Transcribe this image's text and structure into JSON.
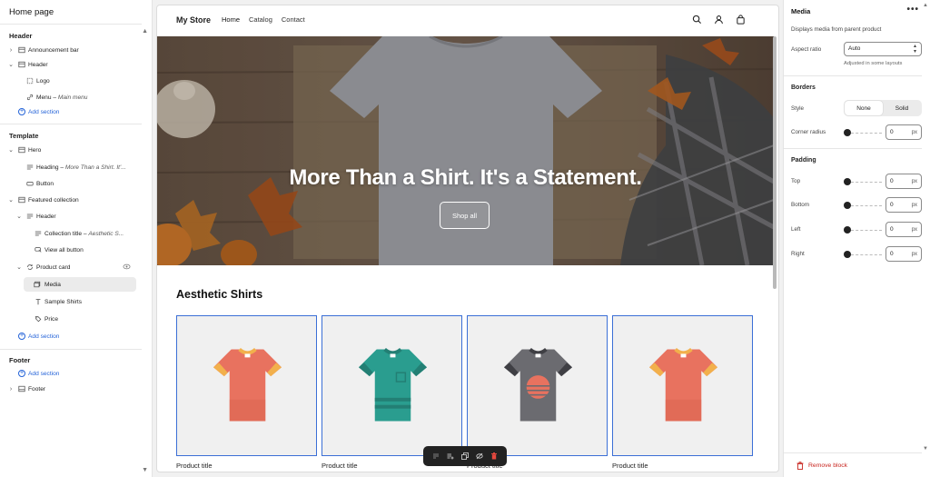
{
  "left": {
    "page_title": "Home page",
    "header_section": "Header",
    "template_section": "Template",
    "footer_section": "Footer",
    "items": {
      "announcement_bar": "Announcement bar",
      "header": "Header",
      "logo": "Logo",
      "menu": "Menu",
      "menu_sub": "Main menu",
      "add_section": "Add section",
      "hero": "Hero",
      "heading": "Heading",
      "heading_sub": "More Than a Shirt. It'...",
      "button": "Button",
      "featured_collection": "Featured collection",
      "fc_header": "Header",
      "collection_title": "Collection title",
      "collection_title_sub": "Aesthetic S...",
      "view_all_button": "View all button",
      "product_card": "Product card",
      "media": "Media",
      "sample_shirts": "Sample Shirts",
      "price": "Price",
      "footer": "Footer"
    },
    "dash": " – "
  },
  "preview": {
    "store_name": "My Store",
    "nav": [
      "Home",
      "Catalog",
      "Contact"
    ],
    "icons": [
      "search-icon",
      "account-icon",
      "cart-icon"
    ],
    "hero_title": "More Than a Shirt. It's a Statement.",
    "hero_button": "Shop all",
    "collection_title": "Aesthetic Shirts",
    "product_title": "Product title",
    "products": [
      {
        "shirt": "coral",
        "body": "#e8725f",
        "trim": "#f2b04c"
      },
      {
        "shirt": "teal-striped",
        "body": "#2a9d8f",
        "trim": "#237f74"
      },
      {
        "shirt": "grey-sunset",
        "body": "#6b6b70",
        "trim": "#3f3f44"
      },
      {
        "shirt": "coral",
        "body": "#e8725f",
        "trim": "#f2b04c"
      }
    ],
    "accent": "#3b6fd6"
  },
  "right": {
    "title": "Media",
    "more": "•••",
    "description": "Displays media from parent product",
    "aspect_ratio_label": "Aspect ratio",
    "aspect_ratio_value": "Auto",
    "aspect_ratio_help": "Adjusted in some layouts",
    "borders_heading": "Borders",
    "style_label": "Style",
    "style_options": [
      "None",
      "Solid"
    ],
    "style_selected": "None",
    "corner_radius_label": "Corner radius",
    "corner_radius_value": "0",
    "unit": "px",
    "padding_heading": "Padding",
    "padding": [
      {
        "label": "Top",
        "value": "0"
      },
      {
        "label": "Bottom",
        "value": "0"
      },
      {
        "label": "Left",
        "value": "0"
      },
      {
        "label": "Right",
        "value": "0"
      }
    ],
    "remove_block": "Remove block"
  }
}
